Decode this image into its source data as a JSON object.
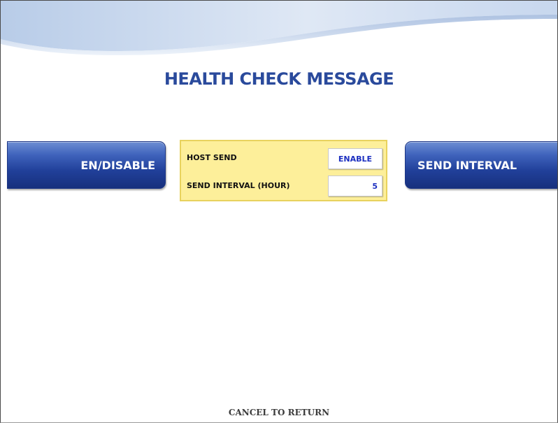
{
  "screen": {
    "title": "HEALTH CHECK MESSAGE",
    "footer": "CANCEL TO RETURN"
  },
  "buttons": {
    "left_label": "EN/DISABLE",
    "right_label": "SEND INTERVAL"
  },
  "settings": {
    "host_send_label": "HOST SEND",
    "host_send_value": "ENABLE",
    "interval_label": "SEND INTERVAL (HOUR)",
    "interval_value": "5"
  },
  "colors": {
    "title": "#2a4a9c",
    "button_blue": "#21409a",
    "panel_yellow": "#fdef9a",
    "value_text": "#1c2fc0"
  }
}
